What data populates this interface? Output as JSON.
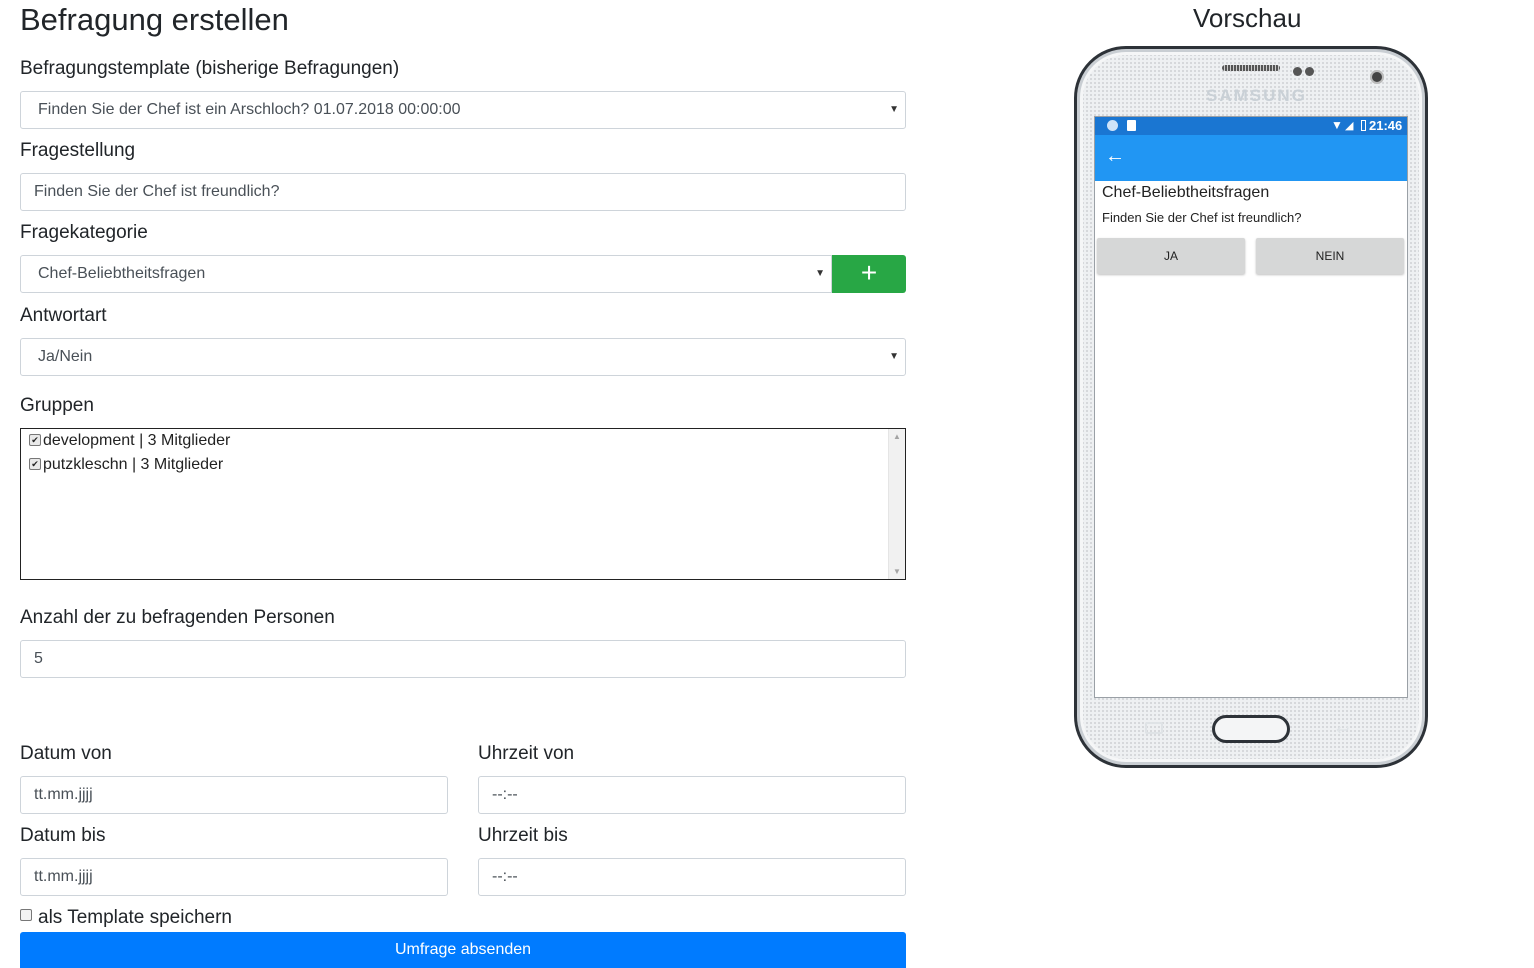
{
  "page": {
    "title": "Befragung erstellen"
  },
  "form": {
    "template": {
      "label": "Befragungstemplate (bisherige Befragungen)",
      "value": "Finden Sie der Chef ist ein Arschloch? 01.07.2018 00:00:00"
    },
    "question": {
      "label": "Fragestellung",
      "value": "Finden Sie der Chef ist freundlich?"
    },
    "category": {
      "label": "Fragekategorie",
      "value": "Chef-Beliebtheitsfragen",
      "add_label": "+"
    },
    "answer_type": {
      "label": "Antwortart",
      "value": "Ja/Nein"
    },
    "groups": {
      "label": "Gruppen",
      "items": [
        {
          "label": "development | 3 Mitglieder",
          "checked": true
        },
        {
          "label": "putzkleschn | 3 Mitglieder",
          "checked": true
        }
      ]
    },
    "persons": {
      "label": "Anzahl der zu befragenden Personen",
      "value": "5"
    },
    "date_from": {
      "label": "Datum von",
      "placeholder": "tt.mm.jjjj"
    },
    "time_from": {
      "label": "Uhrzeit von",
      "placeholder": "--:--"
    },
    "date_to": {
      "label": "Datum bis",
      "placeholder": "tt.mm.jjjj"
    },
    "time_to": {
      "label": "Uhrzeit bis",
      "placeholder": "--:--"
    },
    "save_template": {
      "label": "als Template speichern",
      "checked": false
    },
    "submit_label": "Umfrage absenden"
  },
  "preview": {
    "title": "Vorschau",
    "brand": "SAMSUNG",
    "status_time": "21:46",
    "category": "Chef-Beliebtheitsfragen",
    "question": "Finden Sie der Chef ist freundlich?",
    "buttons": [
      "JA",
      "NEIN"
    ],
    "colors": {
      "status": "#1a76d2",
      "appbar": "#2196f3"
    }
  },
  "colors": {
    "add_button": "#28a745",
    "submit_button": "#007bff"
  }
}
